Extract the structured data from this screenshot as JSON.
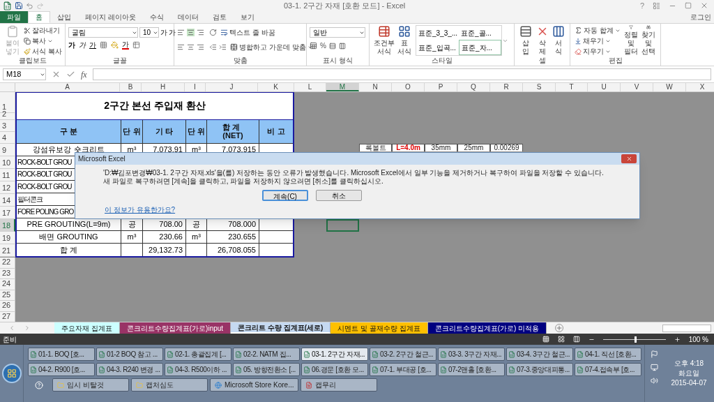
{
  "window": {
    "title": "03-1. 2구간 자재 [호환 모드] - Excel",
    "help": "?",
    "sign_in": "로그인"
  },
  "ribbon_tabs": [
    {
      "label": "파일",
      "kind": "file",
      "selected": false
    },
    {
      "label": "홈",
      "kind": "tab",
      "selected": true
    },
    {
      "label": "삽입",
      "kind": "tab",
      "selected": false
    },
    {
      "label": "페이지 레이아웃",
      "kind": "tab",
      "selected": false
    },
    {
      "label": "수식",
      "kind": "tab",
      "selected": false
    },
    {
      "label": "데이터",
      "kind": "tab",
      "selected": false
    },
    {
      "label": "검토",
      "kind": "tab",
      "selected": false
    },
    {
      "label": "보기",
      "kind": "tab",
      "selected": false
    }
  ],
  "ribbon": {
    "clipboard": {
      "label": "클립보드",
      "paste": "붙여넣기",
      "cut": "잘라내기",
      "copy": "복사",
      "format_painter": "서식 복사"
    },
    "font": {
      "label": "글꼴",
      "font_name": "굴림",
      "font_size": "10",
      "grow": "가",
      "shrink": "가",
      "bold": "가",
      "italic": "가",
      "underline": "가",
      "font_color": "가"
    },
    "alignment": {
      "label": "맞춤",
      "wrap_text": "텍스트 줄 바꿈",
      "merge_center": "병합하고 가운데 맞춤"
    },
    "number": {
      "label": "표시 형식",
      "format": "일반",
      "percent": "%"
    },
    "styles": {
      "label": "스타일",
      "conditional": [
        "조건부",
        "서식"
      ],
      "table": [
        "표",
        "서식"
      ],
      "gallery": [
        {
          "label": "표준_3_3_...",
          "selected": false
        },
        {
          "label": "표준_골...",
          "selected": false
        },
        {
          "label": "표준_입곡...",
          "selected": false
        },
        {
          "label": "표준_자...",
          "selected": true
        }
      ]
    },
    "cells": {
      "label": "셀",
      "insert": "삽입",
      "delete": "삭제",
      "format": "서식"
    },
    "editing": {
      "label": "편집",
      "autosum": "자동 합계",
      "fill": "채우기",
      "clear": "지우기",
      "sort_filter": [
        "정렬 및",
        "필터"
      ],
      "find_select": [
        "찾기 및",
        "선택"
      ]
    }
  },
  "formula_bar": {
    "name_box": "M18",
    "fx": "fx"
  },
  "sheet": {
    "columns": [
      {
        "label": "A",
        "selected": false
      },
      {
        "label": "B",
        "selected": false
      },
      {
        "label": "H",
        "selected": false
      },
      {
        "label": "I",
        "selected": false
      },
      {
        "label": "J",
        "selected": false
      },
      {
        "label": "K",
        "selected": false
      },
      {
        "label": "L",
        "selected": false
      },
      {
        "label": "M",
        "selected": true
      },
      {
        "label": "N",
        "selected": false
      },
      {
        "label": "O",
        "selected": false
      },
      {
        "label": "P",
        "selected": false
      },
      {
        "label": "Q",
        "selected": false
      },
      {
        "label": "R",
        "selected": false
      },
      {
        "label": "S",
        "selected": false
      },
      {
        "label": "T",
        "selected": false
      },
      {
        "label": "U",
        "selected": false
      },
      {
        "label": "V",
        "selected": false
      },
      {
        "label": "W",
        "selected": false
      },
      {
        "label": "X",
        "selected": false
      }
    ],
    "title": "2구간 본선 주입재 환산",
    "header": [
      [
        "구  분"
      ],
      [
        "단 위"
      ],
      [
        "기 타"
      ],
      [
        "단 위"
      ],
      [
        "합 계",
        "(NET)"
      ],
      [
        "비  고"
      ]
    ],
    "title_rows": [
      {
        "number": "1",
        "selected": false
      },
      {
        "number": "2",
        "selected": false
      }
    ],
    "header_rows": [
      {
        "number": "3",
        "selected": false
      },
      {
        "number": "4",
        "selected": false
      }
    ],
    "rows": [
      {
        "number": "9",
        "selected": false,
        "name": "강섬유보강 숏크리트",
        "unit": "m³",
        "other": "7,073.91",
        "unit2": "m³",
        "total": "7,073.915"
      },
      {
        "number": "10",
        "selected": false,
        "name": "ROCK-BOLT GROU",
        "partial": true
      },
      {
        "number": "11",
        "selected": false,
        "name": "ROCK-BOLT GROU",
        "partial": true
      },
      {
        "number": "12",
        "selected": false,
        "name": "ROCK-BOLT GROU",
        "partial": true
      },
      {
        "number": "14",
        "selected": false,
        "name": "필터콘크",
        "partial": true
      },
      {
        "number": "17",
        "selected": false,
        "name": "FORE POLING GRO",
        "partial": true
      },
      {
        "number": "18",
        "selected": true,
        "name": "PRE GROUTING(L=9m)",
        "unit": "공",
        "other": "708.00",
        "unit2": "공",
        "total": "708.000"
      },
      {
        "number": "19",
        "selected": false,
        "name": "배면 GROUTING",
        "unit": "m³",
        "other": "230.66",
        "unit2": "m³",
        "total": "230.655"
      },
      {
        "number": "21",
        "selected": false,
        "name": "합    계",
        "other": "29,132.73",
        "total": "26,708.055"
      }
    ],
    "side_cells": [
      {
        "text": "록볼트",
        "kind": "plain"
      },
      {
        "text": "L=4.0m",
        "kind": "alert"
      },
      {
        "text": "35mm",
        "kind": "plain"
      },
      {
        "text": "25mm",
        "kind": "plain"
      },
      {
        "text": "0.00269",
        "kind": "plain"
      }
    ],
    "empty_rows": [
      {
        "number": "22"
      },
      {
        "number": "23"
      },
      {
        "number": "24"
      },
      {
        "number": "25"
      },
      {
        "number": "26"
      },
      {
        "number": "27"
      }
    ]
  },
  "dialog": {
    "title": "Microsoft Excel",
    "message": "'D:₩김포변경₩03-1. 2구간 자재.xls'을(를) 저장하는 동안 오류가 발생했습니다. Microsoft Excel에서 일부 기능을 제거하거나 복구하여 파일을 저장할 수 있습니다. 새 파일로 복구하려면 [계속]을 클릭하고, 파일을 저장하지 않으려면 [취소]를 클릭하십시오.",
    "buttons": [
      {
        "label": "계속(C)",
        "default": true
      },
      {
        "label": "취소",
        "default": false
      }
    ],
    "link": "이 정보가 유용한가요?"
  },
  "sheet_tabs": [
    {
      "label": "주요자재 집계표",
      "color": "#ccffff",
      "selected": false
    },
    {
      "label": "콘크리트수량집계표(가로)input",
      "color": "#993366",
      "selected": false
    },
    {
      "label": "콘크리트 수량 집계표(세로)",
      "color": "#c5d9f1",
      "selected": true
    },
    {
      "label": "시멘트 및 골재수량 집계표",
      "color": "#ffc000",
      "selected": false
    },
    {
      "label": "콘크리트수량집계표(가로) 미적용",
      "color": "#000080",
      "selected": false
    }
  ],
  "status_bar": {
    "ready": "준비",
    "zoom": "100 %",
    "zoom_slider": {
      "level": 0.5
    }
  },
  "taskbar": {
    "rows": [
      {
        "buttons": [
          {
            "label": "01-1. BOQ  [호...",
            "selected": false
          },
          {
            "label": "01-2 BOQ 참고 ...",
            "selected": false
          },
          {
            "label": "02-1. 총괄집계  [...",
            "selected": false
          },
          {
            "label": "02-2. NATM 집...",
            "selected": false
          },
          {
            "label": "03-1. 2구간 자재...",
            "selected": true
          },
          {
            "label": "03-2. 2구간 철근...",
            "selected": false
          },
          {
            "label": "03-3. 3구간 자재...",
            "selected": false
          },
          {
            "label": "03-4. 3구간 철근...",
            "selected": false
          },
          {
            "label": "04-1. 직선  [호환...",
            "selected": false
          }
        ]
      },
      {
        "buttons": [
          {
            "label": "04-2. R900  [호...",
            "selected": false
          },
          {
            "label": "04-3. R240 변경 ...",
            "selected": false
          },
          {
            "label": "04-3. R500이하 ...",
            "selected": false
          },
          {
            "label": "05. 방향전환소  [...",
            "selected": false
          },
          {
            "label": "06.경문  [호환 모...",
            "selected": false
          },
          {
            "label": "07-1. 부대공  [호...",
            "selected": false
          },
          {
            "label": "07-2맨홀  [호환...",
            "selected": false
          },
          {
            "label": "07-3.중앙대피통...",
            "selected": false
          },
          {
            "label": "07-4.접속부  [호...",
            "selected": false
          }
        ]
      }
    ],
    "launch": [
      {
        "label": "임시 비탈것",
        "kind": "folder"
      },
      {
        "label": "캡처심도",
        "kind": "folder"
      },
      {
        "label": "Microsoft Store Kore...",
        "kind": "browser"
      },
      {
        "label": "캡무리",
        "kind": "document"
      }
    ],
    "clock": {
      "time": "오후 4:18",
      "day": "화요일",
      "date": "2015-04-07"
    }
  }
}
